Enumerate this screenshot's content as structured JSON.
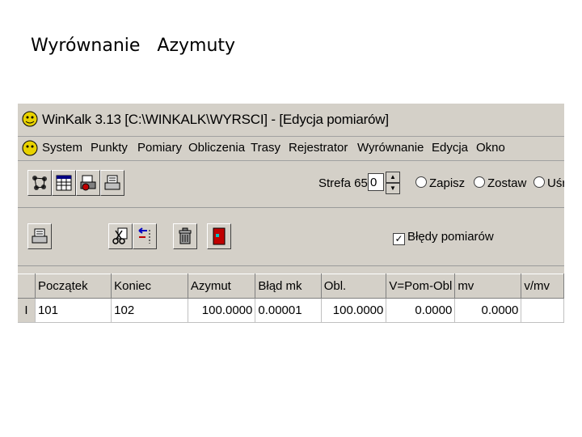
{
  "slide_title": "Wyrównanie Azymuty",
  "window": {
    "title": "WinKalk 3.13 [C:\\WINKALK\\WYRSCI] - [Edycja pomiarów]"
  },
  "menu": [
    "System",
    "Punkty",
    "Pomiary",
    "Obliczenia",
    "Trasy",
    "Rejestrator",
    "Wyrównanie",
    "Edycja",
    "Okno"
  ],
  "toolbar1": {
    "strefa_label": "Strefa 65:",
    "strefa_value": "0",
    "radios": [
      "Zapisz",
      "Zostaw",
      "Uśr"
    ]
  },
  "toolbar2": {
    "checkbox_label": "Błędy pomiarów",
    "checkbox_checked": true
  },
  "table": {
    "columns": [
      "Początek",
      "Koniec",
      "Azymut",
      "Błąd mk",
      "Obl.",
      "V=Pom-Obl",
      "mv",
      "v/mv"
    ],
    "rows": [
      [
        "101",
        "102",
        "100.0000",
        "0.00001",
        "100.0000",
        "0.0000",
        "0.0000",
        ""
      ]
    ]
  },
  "icons": [
    "app-icon",
    "network-icon",
    "table-icon",
    "print-preview-icon",
    "printer-icon",
    "printer-icon",
    "scissors-icon",
    "move-icon",
    "trash-icon",
    "exit-door-icon"
  ],
  "colors": {
    "window_bg": "#d4d0c8",
    "text": "#000000"
  }
}
